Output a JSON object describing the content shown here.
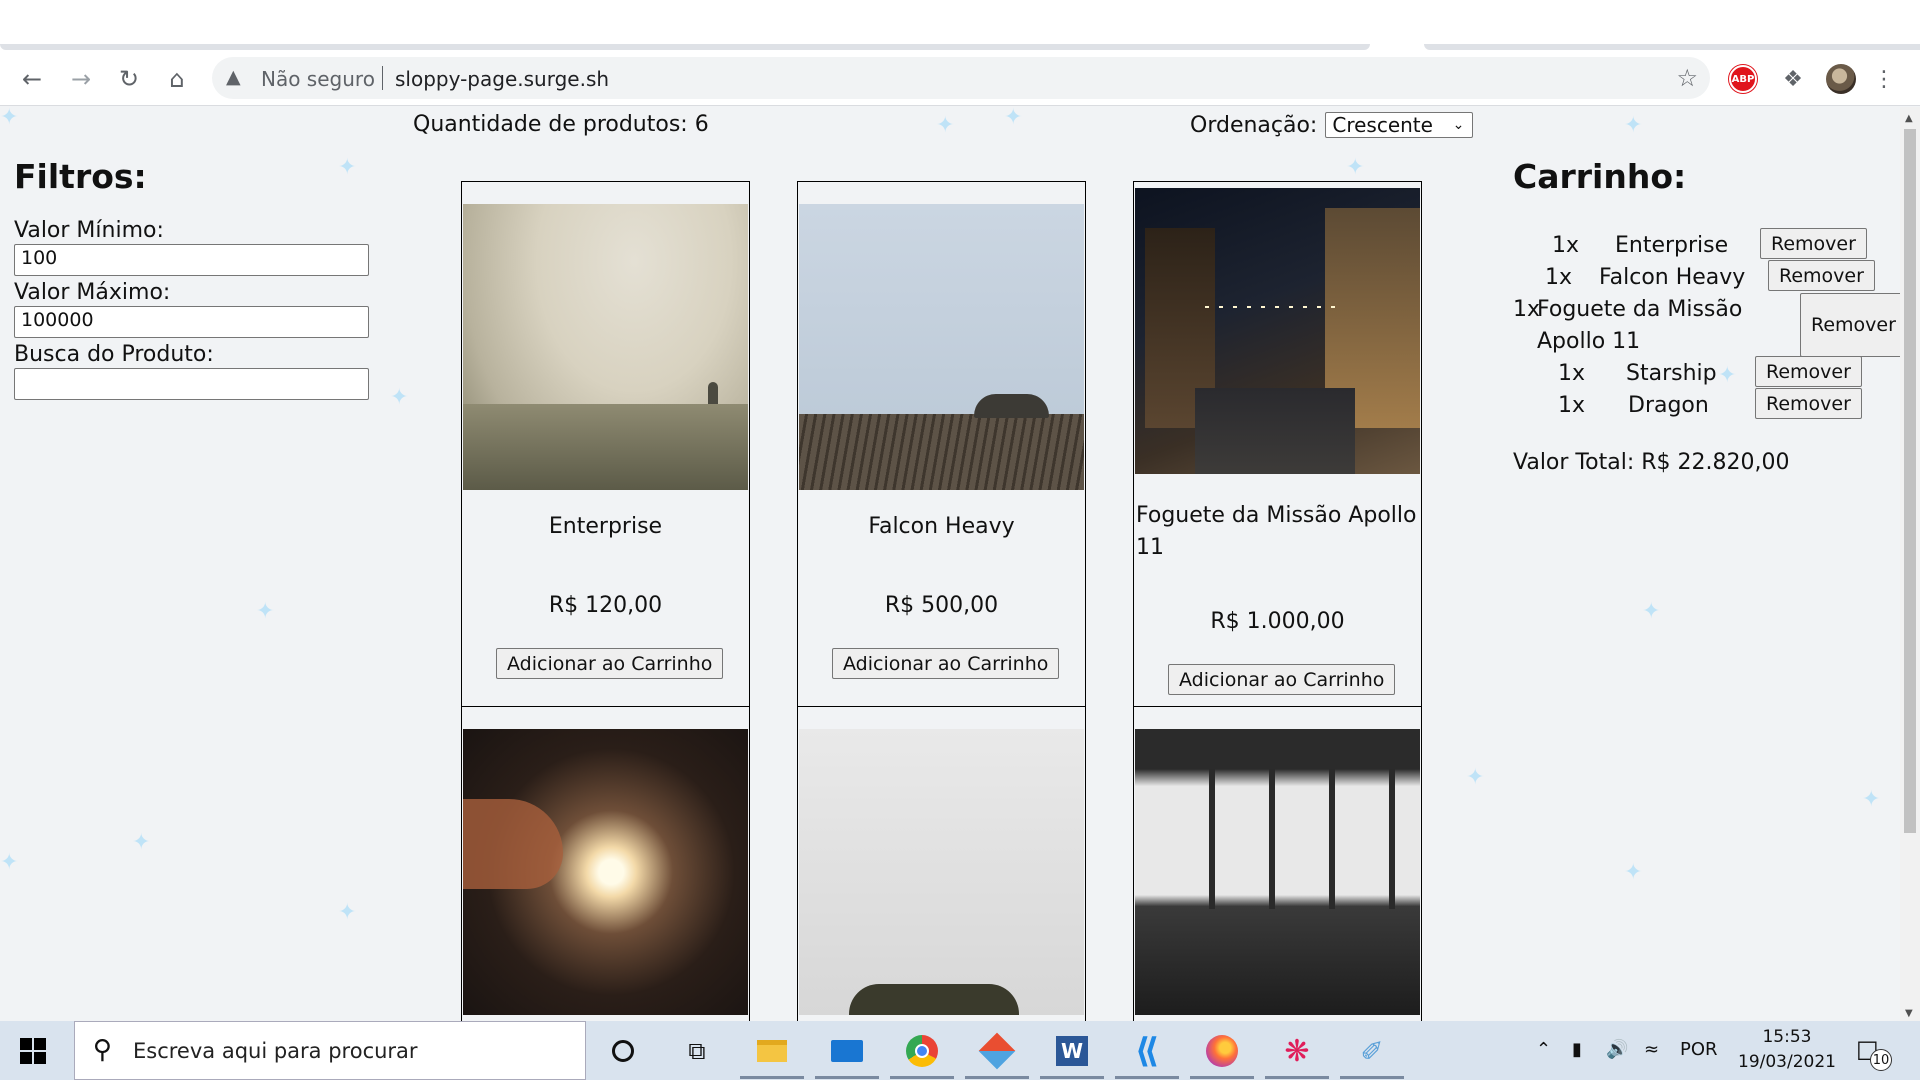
{
  "browser": {
    "security_label": "Não seguro",
    "url": "sloppy-page.surge.sh"
  },
  "page": {
    "quantity_label": "Quantidade de produtos: 6",
    "sort_label": "Ordenação:",
    "sort_value": "Crescente"
  },
  "filters": {
    "title": "Filtros:",
    "min_label": "Valor Mínimo:",
    "min_value": "100",
    "max_label": "Valor Máximo:",
    "max_value": "100000",
    "search_label": "Busca do Produto:",
    "search_value": ""
  },
  "products": [
    {
      "name": "Enterprise",
      "price": "R$ 120,00",
      "button": "Adicionar ao Carrinho",
      "image": "foggy-hill-person"
    },
    {
      "name": "Falcon Heavy",
      "price": "R$ 500,00",
      "button": "Adicionar ao Carrinho",
      "image": "wooden-pier-fog"
    },
    {
      "name": "Foguete da Missão Apollo 11",
      "price": "R$ 1.000,00",
      "button": "Adicionar ao Carrinho",
      "image": "night-street-lights"
    },
    {
      "image": "sparkler-hand"
    },
    {
      "image": "misty-trees"
    },
    {
      "image": "cafe-window-silhouettes"
    }
  ],
  "cart": {
    "title": "Carrinho:",
    "items": [
      {
        "qty": "1x",
        "name": "Enterprise",
        "button": "Remover"
      },
      {
        "qty": "1x",
        "name": "Falcon Heavy",
        "button": "Remover"
      },
      {
        "qty": "1x",
        "name_line1": "Foguete da Missão",
        "name_line2": "Apollo 11",
        "button": "Remover"
      },
      {
        "qty": "1x",
        "name": "Starship",
        "button": "Remover"
      },
      {
        "qty": "1x",
        "name": "Dragon",
        "button": "Remover"
      }
    ],
    "total": "Valor Total: R$ 22.820,00"
  },
  "taskbar": {
    "search_placeholder": "Escreva aqui para procurar",
    "language": "POR",
    "time": "15:53",
    "date": "19/03/2021",
    "notifications": "10",
    "apps": [
      "cortana-icon",
      "task-view-icon",
      "file-explorer-icon",
      "mail-icon",
      "chrome-icon",
      "git-icon",
      "word-icon",
      "vscode-icon",
      "firefox-icon",
      "slack-icon",
      "paint-icon"
    ]
  }
}
